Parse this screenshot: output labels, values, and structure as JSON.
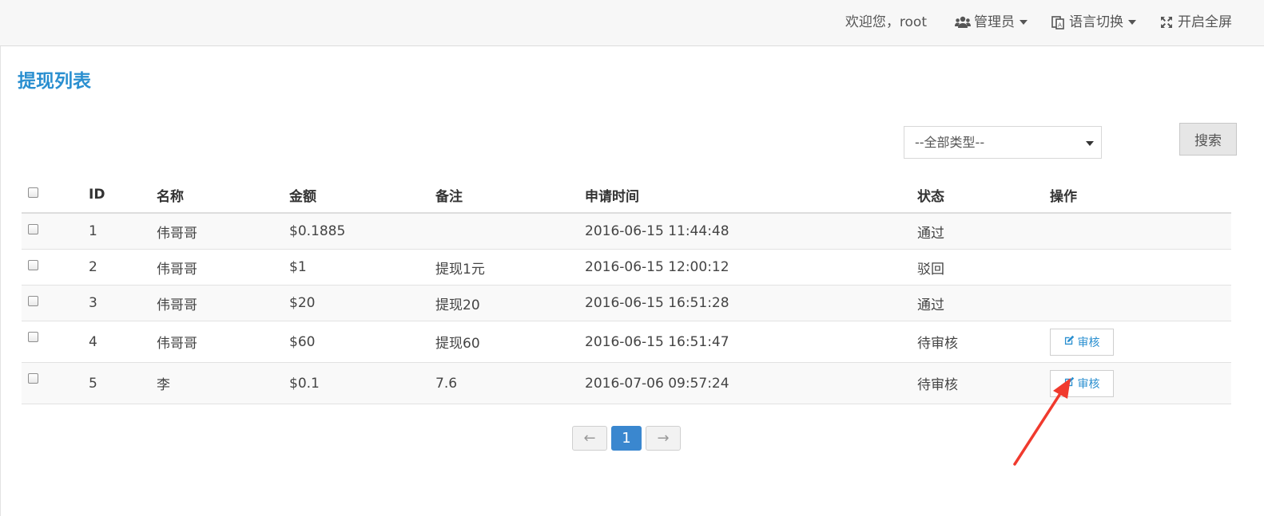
{
  "navbar": {
    "welcome": "欢迎您，root",
    "admin_label": "管理员",
    "language_label": "语言切换",
    "fullscreen_label": "开启全屏"
  },
  "page": {
    "title": "提现列表"
  },
  "filter": {
    "type_select_value": "--全部类型--",
    "search_label": "搜索"
  },
  "table": {
    "headers": {
      "id": "ID",
      "name": "名称",
      "amount": "金额",
      "note": "备注",
      "time": "申请时间",
      "status": "状态",
      "action": "操作"
    },
    "rows": [
      {
        "id": "1",
        "name": "伟哥哥",
        "amount": "$0.1885",
        "note": "",
        "time": "2016-06-15 11:44:48",
        "status": "通过",
        "action": ""
      },
      {
        "id": "2",
        "name": "伟哥哥",
        "amount": "$1",
        "note": "提现1元",
        "time": "2016-06-15 12:00:12",
        "status": "驳回",
        "action": ""
      },
      {
        "id": "3",
        "name": "伟哥哥",
        "amount": "$20",
        "note": "提现20",
        "time": "2016-06-15 16:51:28",
        "status": "通过",
        "action": ""
      },
      {
        "id": "4",
        "name": "伟哥哥",
        "amount": "$60",
        "note": "提现60",
        "time": "2016-06-15 16:51:47",
        "status": "待审核",
        "action": "审核"
      },
      {
        "id": "5",
        "name": "李",
        "amount": "$0.1",
        "note": "7.6",
        "time": "2016-07-06 09:57:24",
        "status": "待审核",
        "action": "审核"
      }
    ]
  },
  "pagination": {
    "prev": "←",
    "current": "1",
    "next": "→"
  },
  "colors": {
    "accent": "#2a8fd0",
    "pager_active": "#3a87cf",
    "annotation_arrow": "#f03a2e"
  },
  "icons": {
    "admin": "users-icon",
    "language": "language-icon",
    "fullscreen": "expand-icon",
    "audit": "edit-icon"
  }
}
